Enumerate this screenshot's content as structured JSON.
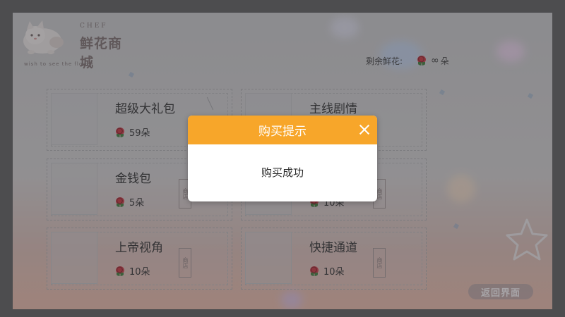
{
  "header": {
    "logo_top": "CHEF",
    "logo_brand": "鲜花商城",
    "logo_sub": "wish to see the flower",
    "remaining_label": "剩余鲜花:",
    "remaining_value": "∞",
    "remaining_unit": "朵"
  },
  "shop": {
    "items": [
      {
        "name": "超级大礼包",
        "price": "59朵"
      },
      {
        "name": "主线剧情",
        "price": ""
      },
      {
        "name": "金钱包",
        "price": "5朵"
      },
      {
        "name": "",
        "price": "10朵"
      },
      {
        "name": "上帝视角",
        "price": "10朵"
      },
      {
        "name": "快捷通道",
        "price": "10朵"
      }
    ],
    "stamp_text": "商店"
  },
  "back_button": "返回界面",
  "dialog": {
    "title": "购买提示",
    "message": "购买成功"
  },
  "colors": {
    "dialog_header": "#f7a62a",
    "rose": "#c7303a"
  },
  "icons": {
    "currency": "rose-icon",
    "close": "close-icon",
    "mascot": "cat-mascot-icon",
    "star": "star-outline-icon"
  }
}
